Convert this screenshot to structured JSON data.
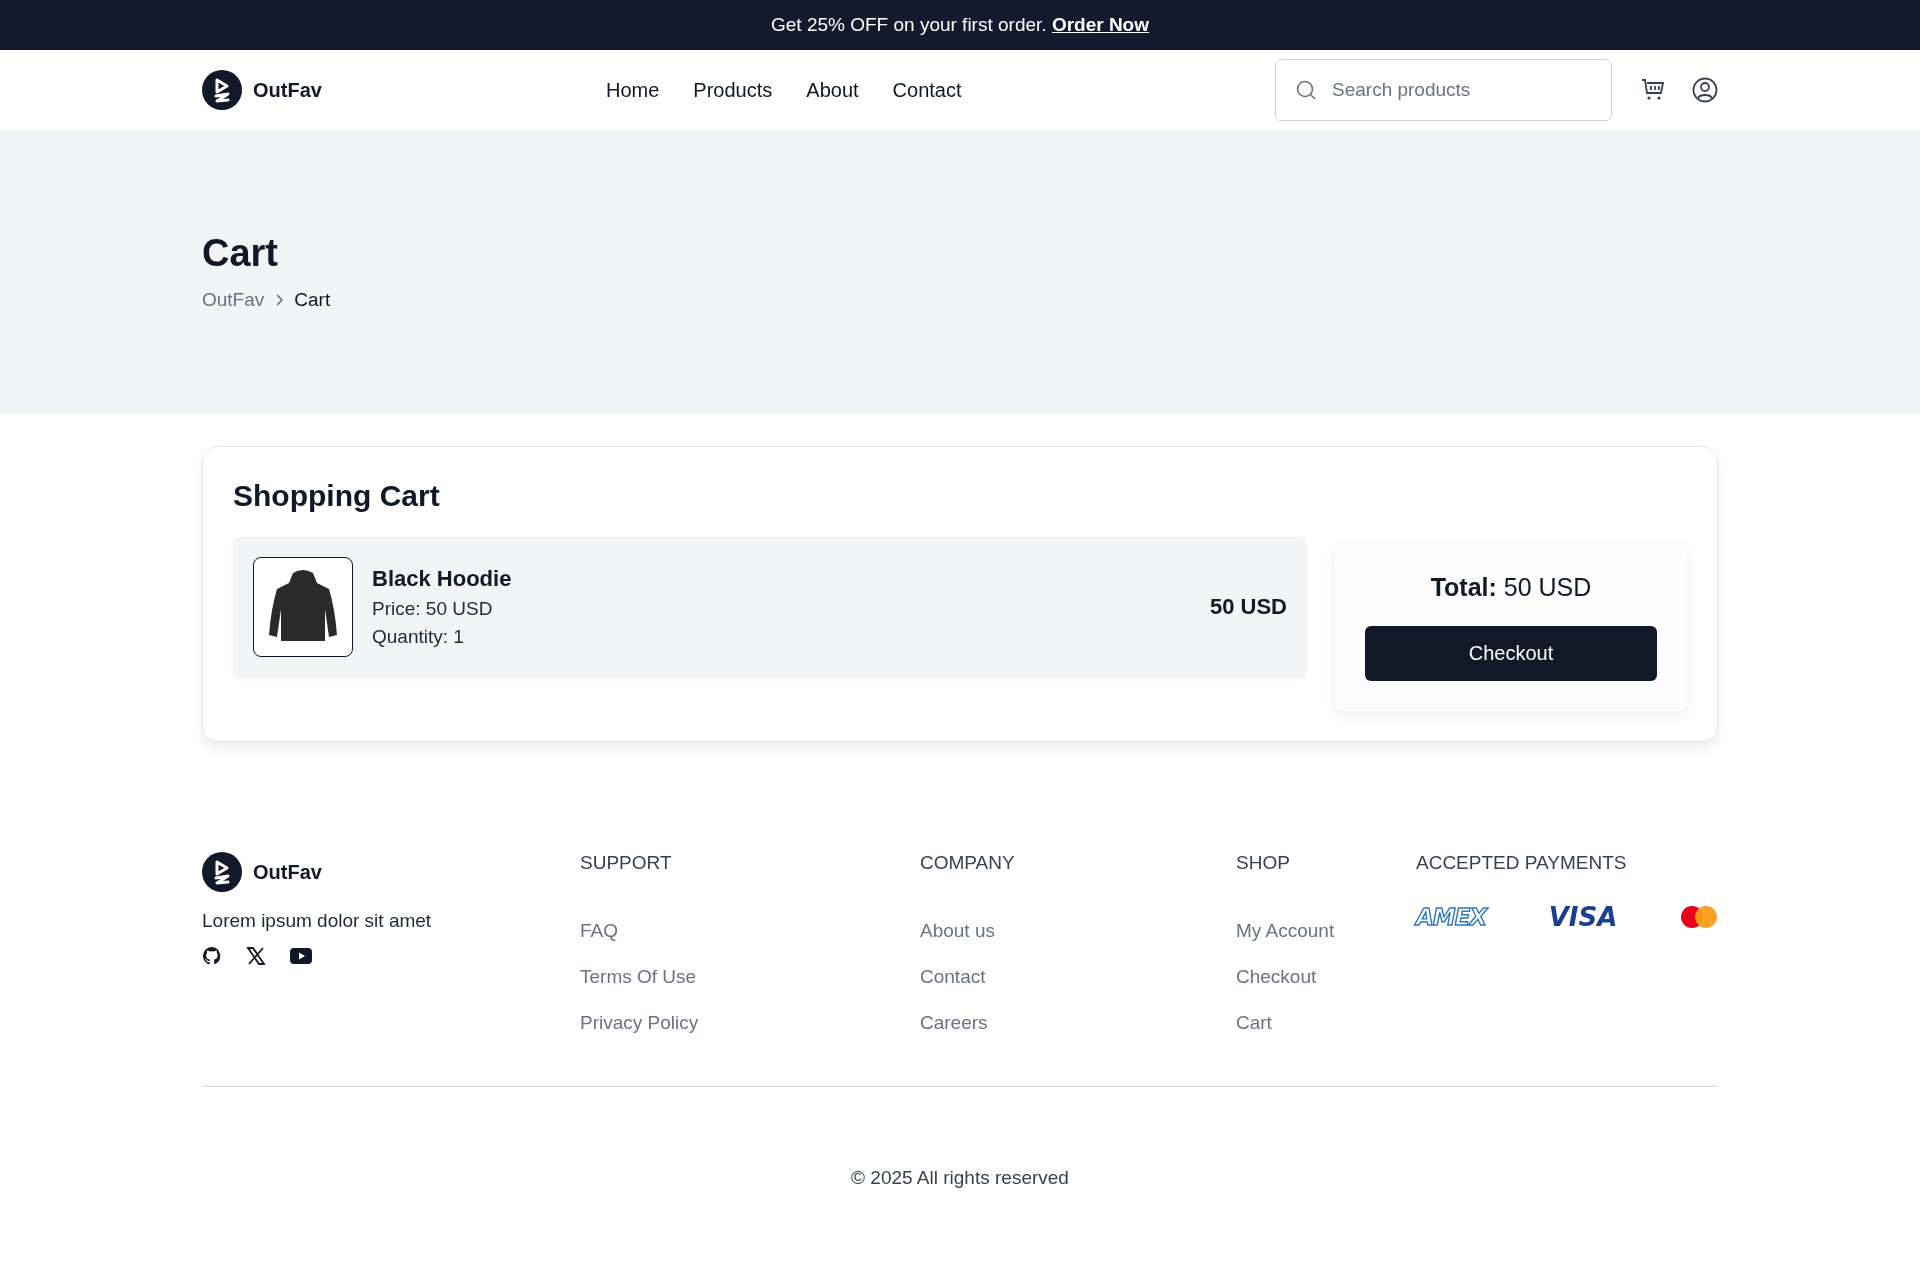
{
  "promo": {
    "text": "Get 25% OFF on your first order.",
    "link": "Order Now"
  },
  "header": {
    "logo": "OutFav",
    "nav": [
      {
        "label": "Home"
      },
      {
        "label": "Products"
      },
      {
        "label": "About"
      },
      {
        "label": "Contact"
      }
    ],
    "search": {
      "placeholder": "Search products"
    }
  },
  "hero": {
    "title": "Cart",
    "breadcrumb": [
      "OutFav",
      "Cart"
    ]
  },
  "cart": {
    "title": "Shopping Cart",
    "items": [
      {
        "name": "Black Hoodie",
        "price": "Price: 50 USD",
        "quantity": "Quantity: 1",
        "total": "50 USD"
      }
    ],
    "summary": {
      "total": "**Total:** 50 USD",
      "button": "Checkout"
    }
  },
  "footer": {
    "logo": "OutFav",
    "tagline": "Lorem ipsum dolor sit amet",
    "columns": [
      {
        "heading": "SUPPORT",
        "links": [
          "FAQ",
          "Terms Of Use",
          "Privacy Policy"
        ]
      },
      {
        "heading": "COMPANY",
        "links": [
          "About us",
          "Contact",
          "Careers"
        ]
      },
      {
        "heading": "SHOP",
        "links": [
          "My Account",
          "Checkout",
          "Cart"
        ]
      }
    ],
    "payments": {
      "heading": "ACCEPTED PAYMENTS",
      "cards": [
        {
          "kind": "amex",
          "label": "AMEX"
        },
        {
          "kind": "visa",
          "label": "VISA"
        },
        {
          "kind": "mastercard"
        }
      ]
    },
    "copyright": "© 2025 All rights reserved"
  }
}
